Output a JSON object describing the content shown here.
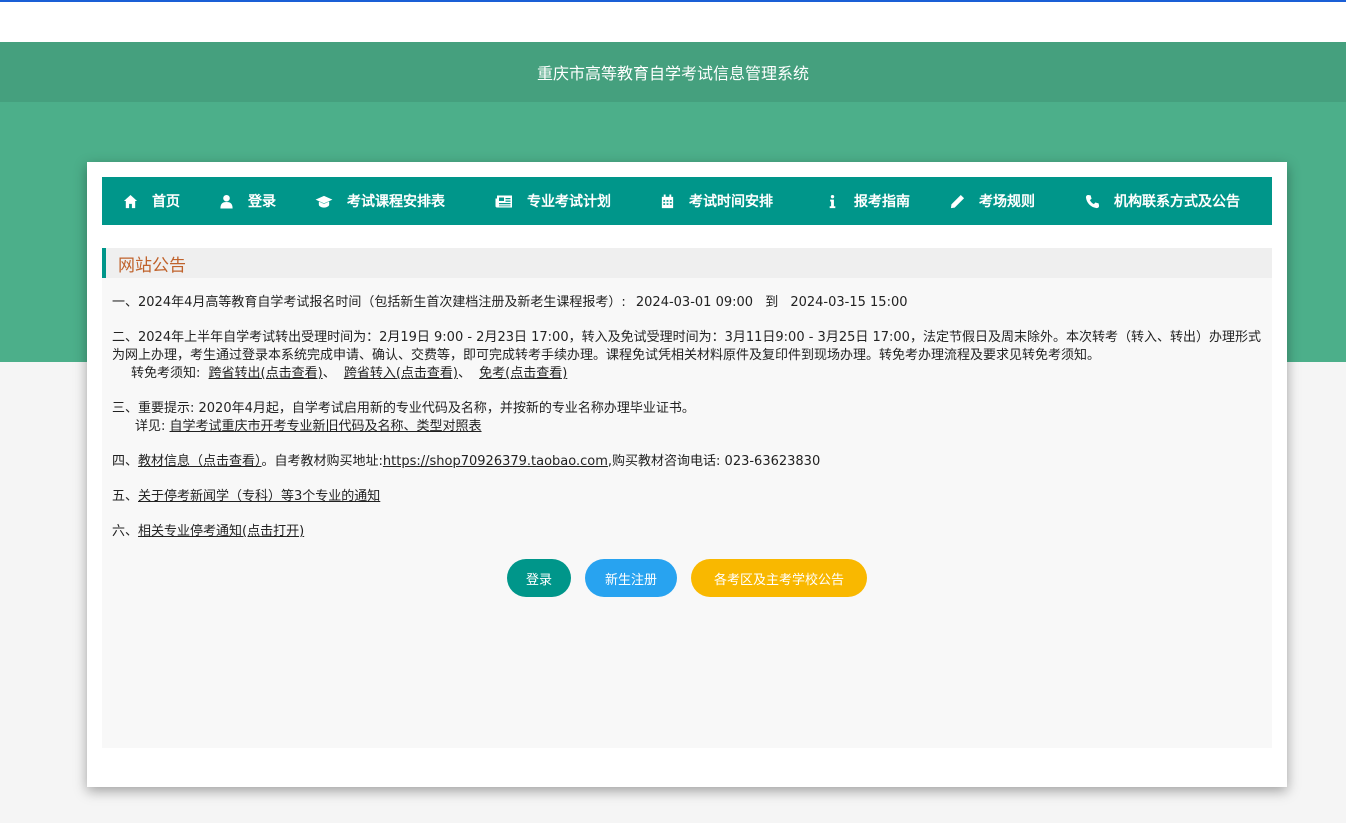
{
  "header": {
    "title": "重庆市高等教育自学考试信息管理系统"
  },
  "nav": {
    "items": [
      {
        "label": "首页",
        "icon": "home-icon"
      },
      {
        "label": "登录",
        "icon": "user-icon"
      },
      {
        "label": "考试课程安排表",
        "icon": "graduation-cap-icon"
      },
      {
        "label": "专业考试计划",
        "icon": "newspaper-icon"
      },
      {
        "label": "考试时间安排",
        "icon": "calendar-icon"
      },
      {
        "label": "报考指南",
        "icon": "info-icon"
      },
      {
        "label": "考场规则",
        "icon": "pencil-icon"
      },
      {
        "label": "机构联系方式及公告",
        "icon": "phone-icon"
      }
    ]
  },
  "notice": {
    "title": "网站公告",
    "p1": {
      "text": "一、2024年4月高等教育自学考试报名时间（包括新生首次建档注册及新老生课程报考）:",
      "start": "2024-03-01 09:00",
      "to": "到",
      "end": "2024-03-15 15:00"
    },
    "p2": {
      "text": "二、2024年上半年自学考试转出受理时间为：2月19日 9:00 - 2月23日 17:00，转入及免试受理时间为：3月11日9:00 - 3月25日 17:00，法定节假日及周末除外。本次转考（转入、转出）办理形式为网上办理，考生通过登录本系统完成申请、确认、交费等，即可完成转考手续办理。课程免试凭相关材料原件及复印件到现场办理。转免考办理流程及要求见转免考须知。",
      "label": "转免考须知:",
      "link1": "跨省转出(点击查看)",
      "sep1": "、",
      "link2": "跨省转入(点击查看)",
      "sep2": "、",
      "link3": "免考(点击查看)"
    },
    "p3": {
      "text": "三、重要提示: 2020年4月起，自学考试启用新的专业代码及名称，并按新的专业名称办理毕业证书。",
      "label": "详见:",
      "link": "自学考试重庆市开考专业新旧代码及名称、类型对照表"
    },
    "p4": {
      "prefix": "四、",
      "link": "教材信息（点击查看）",
      "mid": "。自考教材购买地址:",
      "url": "https://shop70926379.taobao.com",
      "suffix": ",购买教材咨询电话:  023-63623830"
    },
    "p5": {
      "prefix": "五、",
      "link": "关于停考新闻学（专科）等3个专业的通知"
    },
    "p6": {
      "prefix": "六、",
      "link": "相关专业停考通知(点击打开)"
    }
  },
  "buttons": {
    "login": "登录",
    "register": "新生注册",
    "announcement": "各考区及主考学校公告"
  }
}
